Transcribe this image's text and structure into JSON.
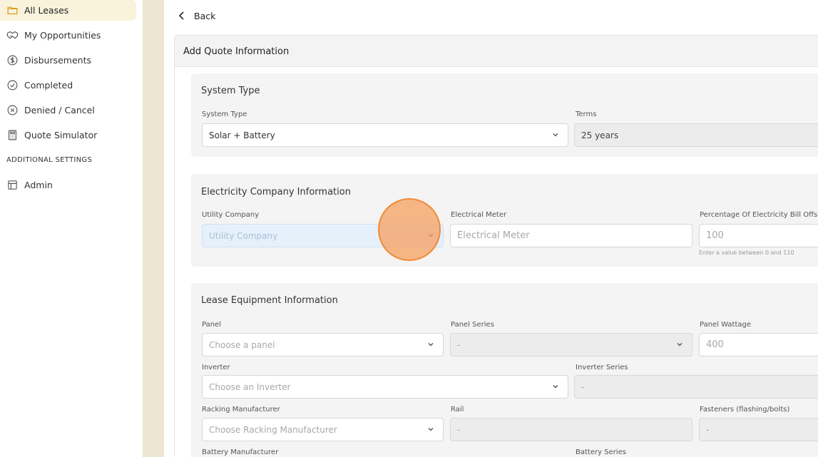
{
  "sidebar": {
    "items": [
      {
        "label": "All Leases",
        "icon": "folder-icon",
        "active": true
      },
      {
        "label": "My Opportunities",
        "icon": "handshake-icon"
      },
      {
        "label": "Disbursements",
        "icon": "dollar-circle-icon"
      },
      {
        "label": "Completed",
        "icon": "check-circle-icon"
      },
      {
        "label": "Denied / Cancel",
        "icon": "x-circle-icon"
      },
      {
        "label": "Quote Simulator",
        "icon": "calculator-icon"
      }
    ],
    "section_label": "ADDITIONAL SETTINGS",
    "admin": {
      "label": "Admin",
      "icon": "layout-icon"
    }
  },
  "back_label": "Back",
  "quote_header": "Add Quote Information",
  "system_type": {
    "title": "System Type",
    "system_type_label": "System Type",
    "system_type_value": "Solar + Battery",
    "terms_label": "Terms",
    "terms_value": "25 years"
  },
  "electricity": {
    "title": "Electricity Company Information",
    "utility_label": "Utility Company",
    "utility_placeholder": "Utility Company",
    "meter_label": "Electrical Meter",
    "meter_placeholder": "Electrical Meter",
    "percentage_label": "Percentage Of Electricity Bill Offs",
    "percentage_placeholder": "100",
    "percentage_hint": "Enter a value between 0 and 110"
  },
  "equipment": {
    "title": "Lease Equipment Information",
    "panel_label": "Panel",
    "panel_placeholder": "Choose a panel",
    "panel_series_label": "Panel Series",
    "panel_series_value": "-",
    "panel_wattage_label": "Panel Wattage",
    "panel_wattage_placeholder": "400",
    "inverter_label": "Inverter",
    "inverter_placeholder": "Choose an Inverter",
    "inverter_series_label": "Inverter Series",
    "inverter_series_value": "-",
    "racking_label": "Racking Manufacturer",
    "racking_placeholder": "Choose Racking Manufacturer",
    "rail_label": "Rail",
    "rail_value": "-",
    "fasteners_label": "Fasteners (flashing/bolts)",
    "fasteners_value": "-",
    "battery_manufacturer_label": "Battery Manufacturer",
    "battery_series_label": "Battery Series"
  },
  "colors": {
    "active_nav_bg": "#faf3dc",
    "gutter": "#ede6d0",
    "card_bg": "#f4f4f4",
    "cursor": "#f08a36",
    "highlight_field": "#e6f0fb"
  }
}
